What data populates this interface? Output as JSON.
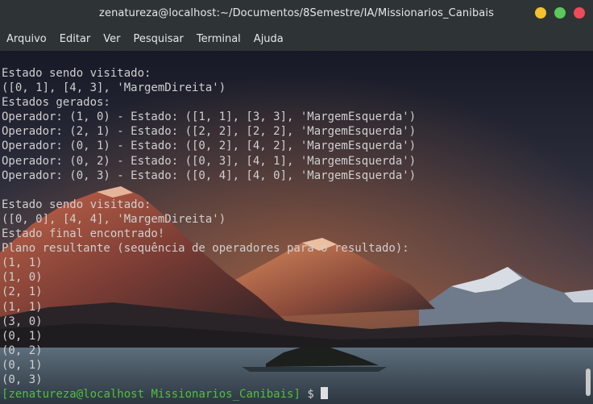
{
  "window": {
    "title": "zenatureza@localhost:~/Documentos/8Semestre/IA/Missionarios_Canibais"
  },
  "menu": {
    "items": [
      "Arquivo",
      "Editar",
      "Ver",
      "Pesquisar",
      "Terminal",
      "Ajuda"
    ]
  },
  "terminal": {
    "lines": [
      "Estado sendo visitado:",
      "([0, 1], [4, 3], 'MargemDireita')",
      "Estados gerados:",
      "Operador: (1, 0) - Estado: ([1, 1], [3, 3], 'MargemEsquerda')",
      "Operador: (2, 1) - Estado: ([2, 2], [2, 2], 'MargemEsquerda')",
      "Operador: (0, 1) - Estado: ([0, 2], [4, 2], 'MargemEsquerda')",
      "Operador: (0, 2) - Estado: ([0, 3], [4, 1], 'MargemEsquerda')",
      "Operador: (0, 3) - Estado: ([0, 4], [4, 0], 'MargemEsquerda')",
      "",
      "Estado sendo visitado:",
      "([0, 0], [4, 4], 'MargemDireita')",
      "Estado final encontrado!",
      "Plano resultante (sequência de operadores para o resultado):",
      "(1, 1)",
      "(1, 0)",
      "(2, 1)",
      "(1, 1)",
      "(3, 0)",
      "(0, 1)",
      "(0, 2)",
      "(0, 1)",
      "(0, 3)"
    ],
    "prompt": {
      "open_bracket": "[",
      "user_host": "zenatureza@localhost",
      "directory": "Missionarios_Canibais",
      "close_bracket": "]",
      "symbol": "$"
    }
  },
  "colors": {
    "text": "#cfcfcf",
    "prompt_green": "#4fbf3c",
    "titlebar": "#2e3436"
  }
}
